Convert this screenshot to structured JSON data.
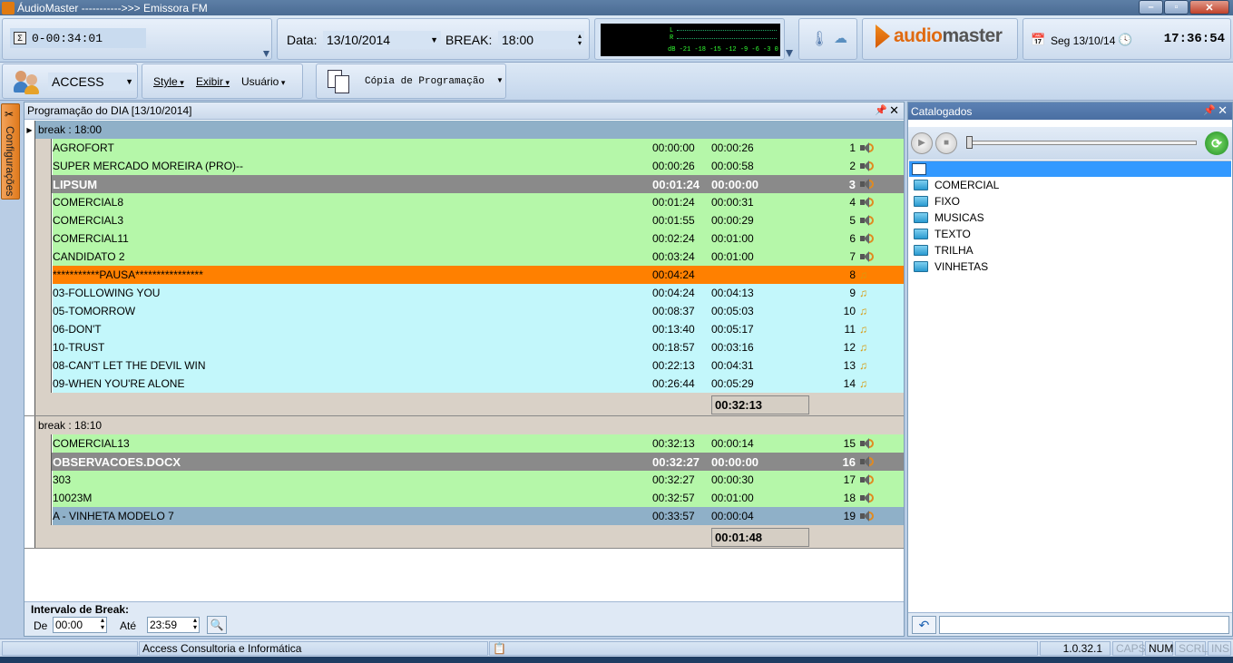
{
  "window": {
    "title": "ÁudioMaster  ----------->>>  Emissora FM"
  },
  "toolbar": {
    "timer": "0-00:34:01",
    "date_label": "Data:",
    "date_value": "13/10/2014",
    "break_label": "BREAK:",
    "break_value": "18:00",
    "meter_lr": "L\nR",
    "meter_scale": "dB  -21 -18 -15 -12  -9  -6  -3   0",
    "logo_prefix": "audio",
    "logo_suffix": "master",
    "date_short": "Seg 13/10/14",
    "clock": "17:36:54"
  },
  "toolbar2": {
    "user": "ACCESS",
    "menu_style": "Style",
    "menu_exibir": "Exibir",
    "menu_usuario": "Usuário",
    "copy_label": "Cópia de Programação"
  },
  "sidetab": {
    "label": "Configurações"
  },
  "program_panel": {
    "title": "Programação do DIA [13/10/2014]",
    "breaks": [
      {
        "title": "break : 18:00",
        "rows": [
          {
            "name": "AGROFORT",
            "start": "00:00:00",
            "dur": "00:00:26",
            "no": "1",
            "kind": "green",
            "icon": "speaker"
          },
          {
            "name": "SUPER MERCADO MOREIRA (PRO)--",
            "start": "00:00:26",
            "dur": "00:00:58",
            "no": "2",
            "kind": "green",
            "icon": "speaker"
          },
          {
            "name": "LIPSUM",
            "start": "00:01:24",
            "dur": "00:00:00",
            "no": "3",
            "kind": "gray",
            "icon": "speaker"
          },
          {
            "name": "COMERCIAL8",
            "start": "00:01:24",
            "dur": "00:00:31",
            "no": "4",
            "kind": "green",
            "icon": "speaker"
          },
          {
            "name": "COMERCIAL3",
            "start": "00:01:55",
            "dur": "00:00:29",
            "no": "5",
            "kind": "green",
            "icon": "speaker"
          },
          {
            "name": "COMERCIAL11",
            "start": "00:02:24",
            "dur": "00:01:00",
            "no": "6",
            "kind": "green",
            "icon": "speaker"
          },
          {
            "name": "CANDIDATO 2",
            "start": "00:03:24",
            "dur": "00:01:00",
            "no": "7",
            "kind": "green",
            "icon": "speaker"
          },
          {
            "name": "***********PAUSA****************",
            "start": "00:04:24",
            "dur": "",
            "no": "8",
            "kind": "orange",
            "icon": "note"
          },
          {
            "name": "03-FOLLOWING YOU",
            "start": "00:04:24",
            "dur": "00:04:13",
            "no": "9",
            "kind": "cyan",
            "icon": "note"
          },
          {
            "name": "05-TOMORROW",
            "start": "00:08:37",
            "dur": "00:05:03",
            "no": "10",
            "kind": "cyan",
            "icon": "note"
          },
          {
            "name": "06-DON'T",
            "start": "00:13:40",
            "dur": "00:05:17",
            "no": "11",
            "kind": "cyan",
            "icon": "note"
          },
          {
            "name": "10-TRUST",
            "start": "00:18:57",
            "dur": "00:03:16",
            "no": "12",
            "kind": "cyan",
            "icon": "note"
          },
          {
            "name": "08-CAN'T LET THE DEVIL WIN",
            "start": "00:22:13",
            "dur": "00:04:31",
            "no": "13",
            "kind": "cyan",
            "icon": "note"
          },
          {
            "name": "09-WHEN YOU'RE ALONE",
            "start": "00:26:44",
            "dur": "00:05:29",
            "no": "14",
            "kind": "cyan",
            "icon": "note"
          }
        ],
        "total": "00:32:13"
      },
      {
        "title": "break : 18:10",
        "rows": [
          {
            "name": "COMERCIAL13",
            "start": "00:32:13",
            "dur": "00:00:14",
            "no": "15",
            "kind": "green",
            "icon": "speaker"
          },
          {
            "name": "OBSERVACOES.DOCX",
            "start": "00:32:27",
            "dur": "00:00:00",
            "no": "16",
            "kind": "gray",
            "icon": "speaker"
          },
          {
            "name": "303",
            "start": "00:32:27",
            "dur": "00:00:30",
            "no": "17",
            "kind": "green",
            "icon": "speaker"
          },
          {
            "name": "10023M",
            "start": "00:32:57",
            "dur": "00:01:00",
            "no": "18",
            "kind": "green",
            "icon": "speaker"
          },
          {
            "name": "A - VINHETA MODELO 7",
            "start": "00:33:57",
            "dur": "00:00:04",
            "no": "19",
            "kind": "steel",
            "icon": "speaker"
          }
        ],
        "total": "00:01:48"
      }
    ],
    "filter": {
      "title": "Intervalo de Break:",
      "from_label": "De",
      "from_value": "00:00",
      "to_label": "Até",
      "to_value": "23:59"
    }
  },
  "catalog_panel": {
    "title": "Catalogados",
    "folders": [
      "COMERCIAL",
      "FIXO",
      "MUSICAS",
      "TEXTO",
      "TRILHA",
      "VINHETAS"
    ]
  },
  "statusbar": {
    "company": "Access Consultoria e Informática",
    "version": "1.0.32.1",
    "caps": "CAPS",
    "num": "NUM",
    "scrl": "SCRL",
    "ins": "INS"
  }
}
